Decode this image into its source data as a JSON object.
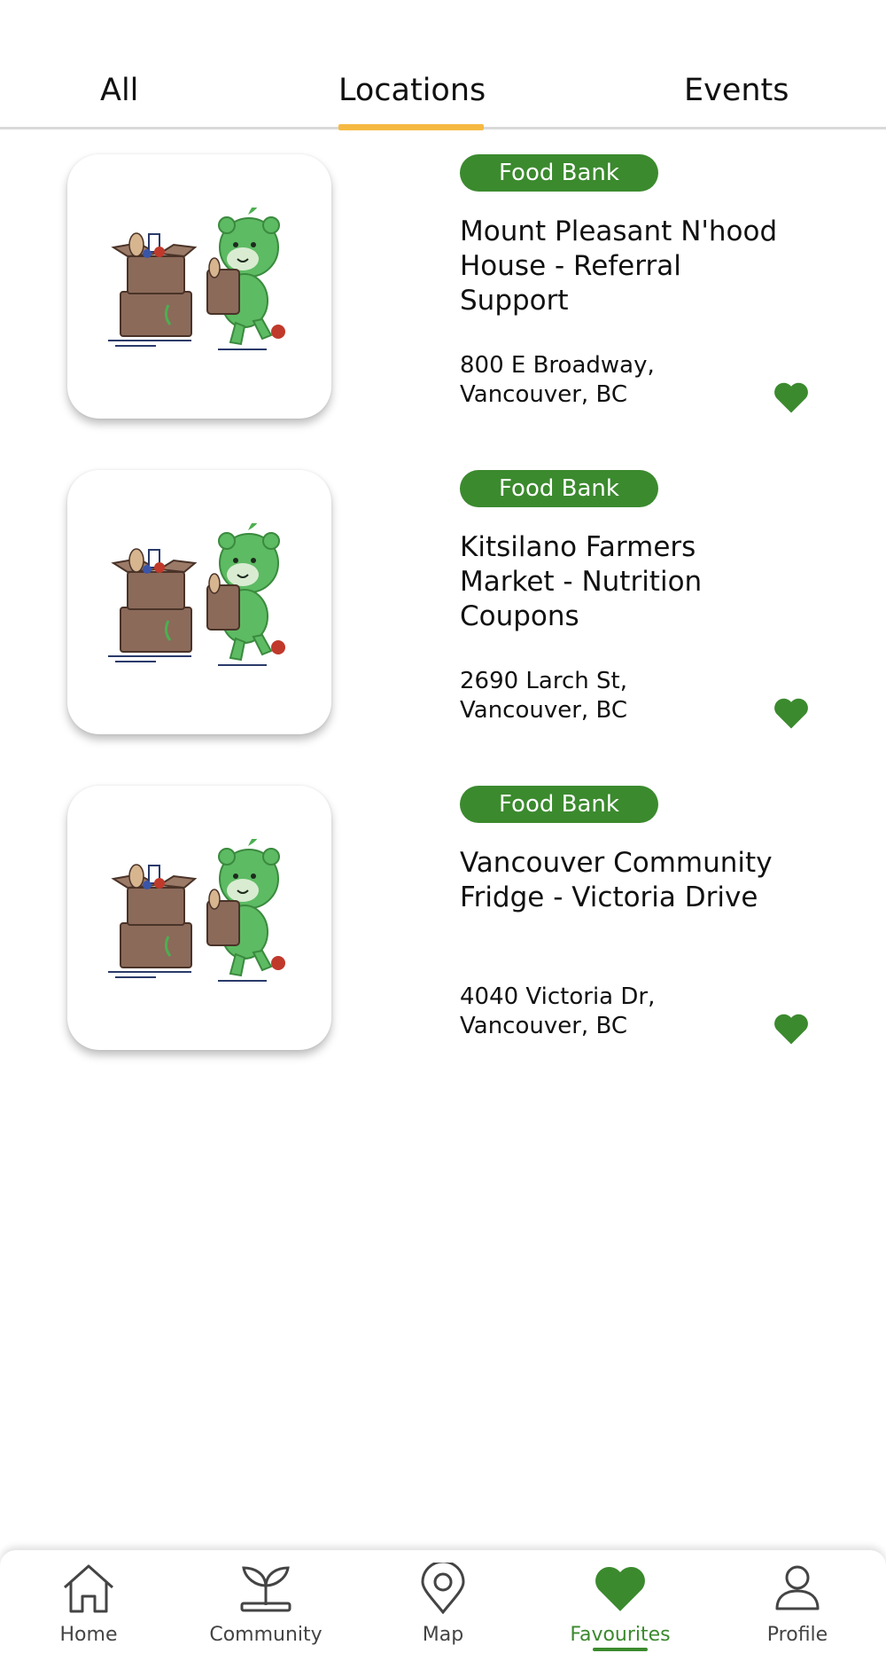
{
  "tabs": {
    "all": "All",
    "locations": "Locations",
    "events": "Events",
    "active": "Locations"
  },
  "cards": [
    {
      "badge": "Food Bank",
      "title": "Mount Pleasant N'hood House - Referral Support",
      "address_line1": "800 E Broadway,",
      "address_line2": "Vancouver, BC",
      "favourited": true
    },
    {
      "badge": "Food Bank",
      "title": "Kitsilano Farmers Market - Nutrition Coupons",
      "address_line1": "2690 Larch St,",
      "address_line2": "Vancouver, BC",
      "favourited": true
    },
    {
      "badge": "Food Bank",
      "title": "Vancouver Community Fridge - Victoria Drive",
      "address_line1": "4040 Victoria Dr,",
      "address_line2": "Vancouver, BC",
      "favourited": true
    }
  ],
  "nav": {
    "home": "Home",
    "community": "Community",
    "map": "Map",
    "favourites": "Favourites",
    "profile": "Profile",
    "active": "Favourites"
  },
  "colors": {
    "accent_green": "#3b8a2e",
    "tab_indicator": "#f5b942"
  },
  "icons": [
    "house-icon",
    "sprout-icon",
    "map-pin-icon",
    "heart-icon",
    "person-icon",
    "bear-mascot-illustration"
  ]
}
